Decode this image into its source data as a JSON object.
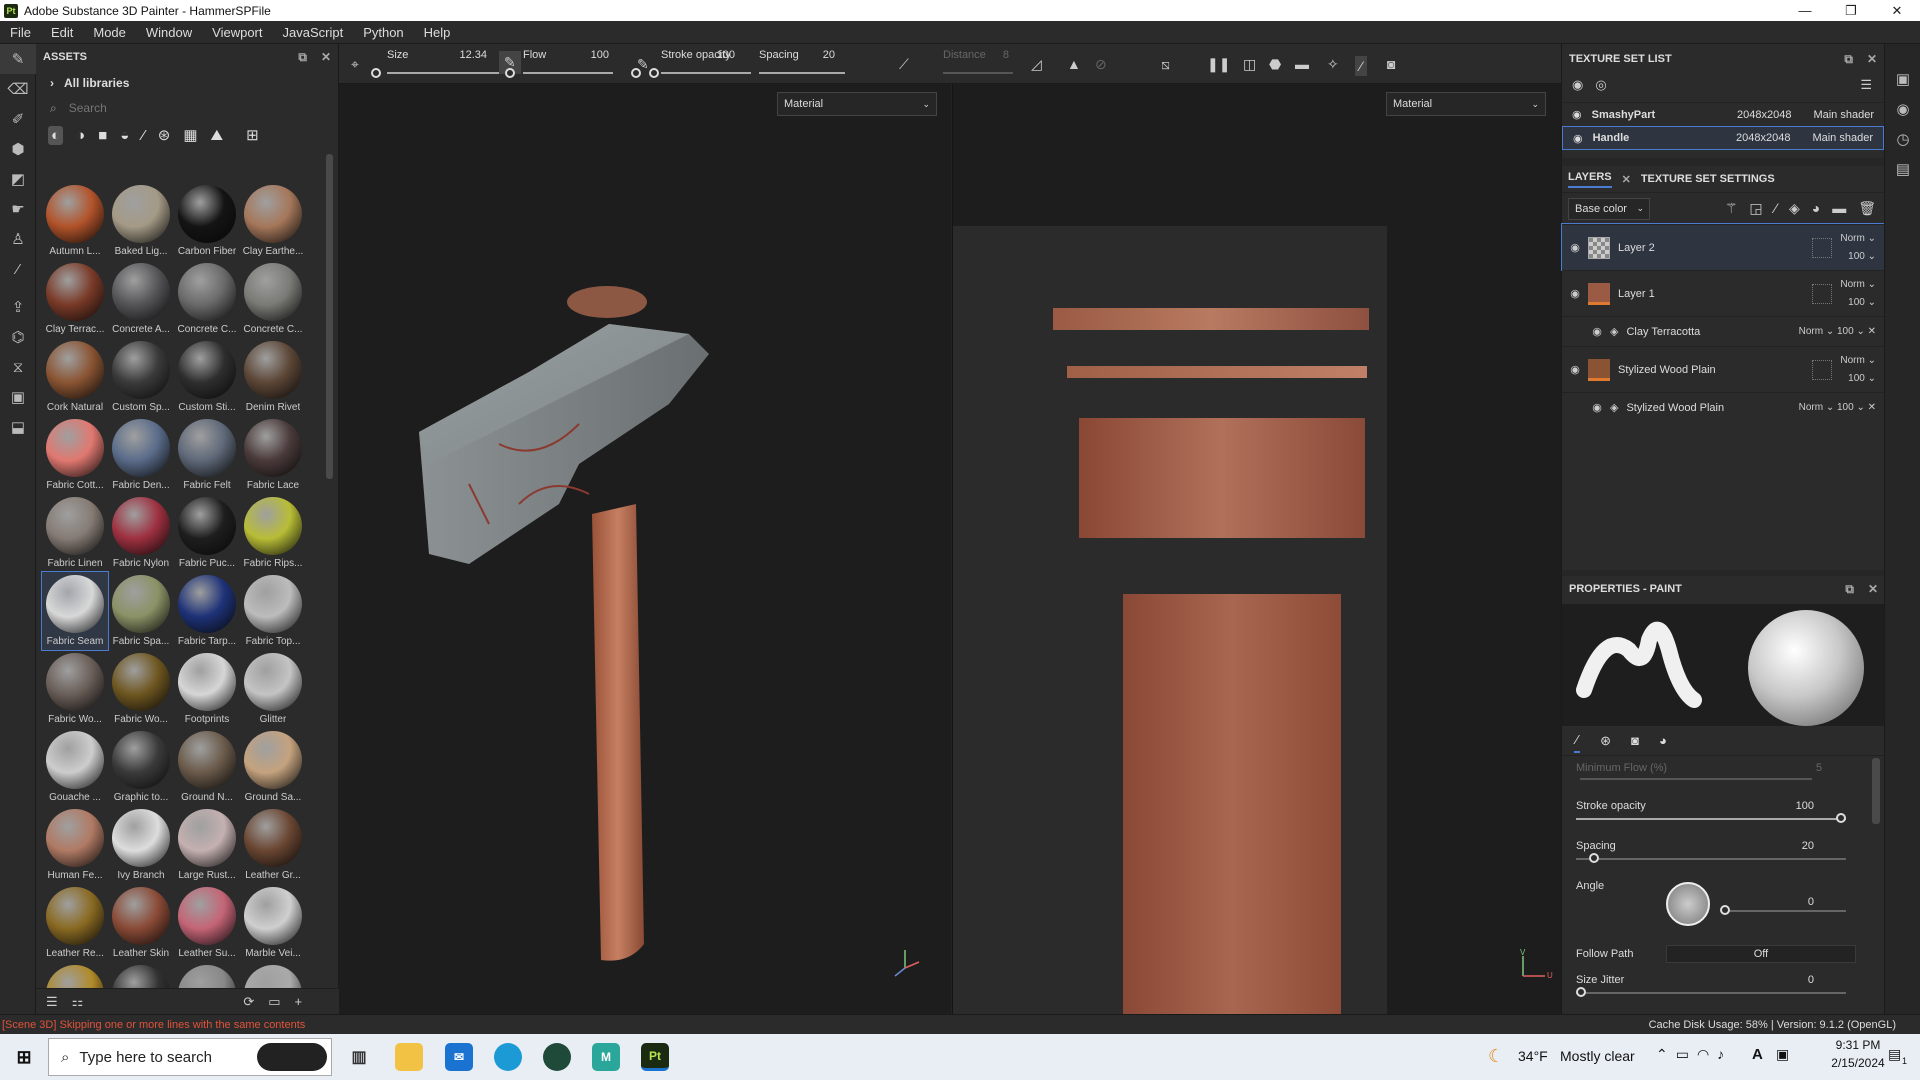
{
  "window": {
    "title": "Adobe Substance 3D Painter - HammerSPFile",
    "logo": "Pt",
    "controls": [
      "—",
      "❐",
      "✕"
    ]
  },
  "menu": [
    "File",
    "Edit",
    "Mode",
    "Window",
    "Viewport",
    "JavaScript",
    "Python",
    "Help"
  ],
  "assets": {
    "title": "ASSETS",
    "all_libraries": "All libraries",
    "search_placeholder": "Search",
    "items": [
      {
        "name": "Autumn L...",
        "color": "#b2532a"
      },
      {
        "name": "Baked Lig...",
        "color": "#a49a86"
      },
      {
        "name": "Carbon Fiber",
        "color": "#141414"
      },
      {
        "name": "Clay Earthe...",
        "color": "#a5775a"
      },
      {
        "name": "Clay Terrac...",
        "color": "#7a3a28"
      },
      {
        "name": "Concrete A...",
        "color": "#555558"
      },
      {
        "name": "Concrete C...",
        "color": "#6a6a6a"
      },
      {
        "name": "Concrete C...",
        "color": "#7a7a76"
      },
      {
        "name": "Cork Natural",
        "color": "#8a5433"
      },
      {
        "name": "Custom Sp...",
        "color": "#3a3a3a"
      },
      {
        "name": "Custom Sti...",
        "color": "#2e2e2e"
      },
      {
        "name": "Denim Rivet",
        "color": "#5c4636"
      },
      {
        "name": "Fabric Cott...",
        "color": "#e07870"
      },
      {
        "name": "Fabric Den...",
        "color": "#5a6c8a"
      },
      {
        "name": "Fabric Felt",
        "color": "#5e6878"
      },
      {
        "name": "Fabric Lace",
        "color": "#4a3a3a"
      },
      {
        "name": "Fabric Linen",
        "color": "#857b74"
      },
      {
        "name": "Fabric Nylon",
        "color": "#9e3040"
      },
      {
        "name": "Fabric Puc...",
        "color": "#1e1e1e"
      },
      {
        "name": "Fabric Rips...",
        "color": "#b8bd36"
      },
      {
        "name": "Fabric Seam",
        "color": "#d8d8d8"
      },
      {
        "name": "Fabric Spa...",
        "color": "#8a9266"
      },
      {
        "name": "Fabric Tarp...",
        "color": "#1e3278"
      },
      {
        "name": "Fabric Top...",
        "color": "#bcbcbc"
      },
      {
        "name": "Fabric Wo...",
        "color": "#6a5e58"
      },
      {
        "name": "Fabric Wo...",
        "color": "#6e5620"
      },
      {
        "name": "Footprints",
        "color": "#d6d6d6"
      },
      {
        "name": "Glitter",
        "color": "#c4c4c4"
      },
      {
        "name": "Gouache ...",
        "color": "#cdcdcd"
      },
      {
        "name": "Graphic to...",
        "color": "#3a3a3a"
      },
      {
        "name": "Ground N...",
        "color": "#6a5a4a"
      },
      {
        "name": "Ground Sa...",
        "color": "#c4a27e"
      },
      {
        "name": "Human Fe...",
        "color": "#b07a64"
      },
      {
        "name": "Ivy Branch",
        "color": "#dddddd"
      },
      {
        "name": "Large Rust...",
        "color": "#c4b0b0"
      },
      {
        "name": "Leather Gr...",
        "color": "#6a4632"
      },
      {
        "name": "Leather Re...",
        "color": "#8a6a22"
      },
      {
        "name": "Leather Skin",
        "color": "#8a4a36"
      },
      {
        "name": "Leather Su...",
        "color": "#c46476"
      },
      {
        "name": "Marble Vei...",
        "color": "#cfcfcf"
      },
      {
        "name": "",
        "color": "#b08a28"
      },
      {
        "name": "",
        "color": "#333333"
      },
      {
        "name": "",
        "color": "#888888"
      },
      {
        "name": "",
        "color": "#aaaaaa"
      }
    ]
  },
  "toolbar": {
    "size_label": "Size",
    "size_value": "12.34",
    "flow_label": "Flow",
    "flow_value": "100",
    "stroke_label": "Stroke opacity",
    "stroke_value": "100",
    "spacing_label": "Spacing",
    "spacing_value": "20",
    "distance_label": "Distance",
    "distance_value": "8"
  },
  "viewport": {
    "dropdown_3d": "Material",
    "dropdown_2d": "Material",
    "axis_2d_v": "V",
    "axis_2d_u": "U"
  },
  "texture_set_list": {
    "title": "TEXTURE SET LIST",
    "items": [
      {
        "name": "SmashyPart",
        "res": "2048x2048",
        "shader": "Main shader"
      },
      {
        "name": "Handle",
        "res": "2048x2048",
        "shader": "Main shader"
      }
    ]
  },
  "layers": {
    "tab_layers": "LAYERS",
    "tab_settings": "TEXTURE SET SETTINGS",
    "channel": "Base color",
    "items": [
      {
        "name": "Layer 2",
        "mode": "Norm",
        "opacity": "100"
      },
      {
        "name": "Layer 1",
        "mode": "Norm",
        "opacity": "100"
      },
      {
        "name": "Clay Terracotta",
        "mode": "Norm",
        "opacity": "100"
      },
      {
        "name": "Stylized Wood Plain",
        "mode": "Norm",
        "opacity": "100"
      },
      {
        "name": "Stylized Wood Plain",
        "mode": "Norm",
        "opacity": "100"
      }
    ]
  },
  "properties": {
    "title": "PROPERTIES - PAINT",
    "min_flow_label": "Minimum Flow (%)",
    "min_flow_value": "5",
    "stroke_label": "Stroke opacity",
    "stroke_value": "100",
    "stroke_fraction": 1.0,
    "spacing_label": "Spacing",
    "spacing_value": "20",
    "spacing_fraction": 0.05,
    "angle_label": "Angle",
    "angle_value": "0",
    "follow_label": "Follow Path",
    "follow_value": "Off",
    "jitter_label": "Size Jitter",
    "jitter_value": "0"
  },
  "status": {
    "message": "[Scene 3D] Skipping one or more lines with the same contents",
    "right": "Cache Disk Usage:  58% | Version: 9.1.2 (OpenGL)"
  },
  "taskbar": {
    "search_placeholder": "Type here to search",
    "weather_temp": "34°F",
    "weather_text": "Mostly clear",
    "time": "9:31 PM",
    "date": "2/15/2024",
    "notif_count": "1"
  },
  "colors": {
    "accent": "#4a7bd0",
    "panel": "#2b2b2b",
    "viewport": "#1d1d1d",
    "status_error": "#e0533a"
  }
}
